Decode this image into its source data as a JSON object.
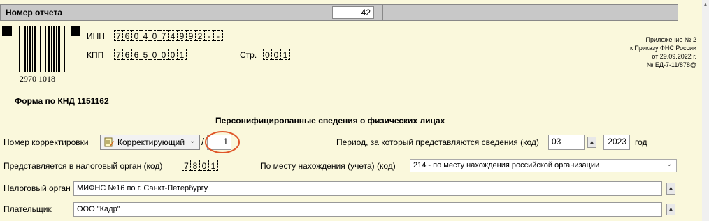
{
  "header": {
    "title": "Номер отчета",
    "report_number": "42"
  },
  "barcode": {
    "number": "2970 1018"
  },
  "inn": {
    "label": "ИНН",
    "cells": [
      "7",
      "6",
      "0",
      "4",
      "0",
      "7",
      "4",
      "9",
      "9",
      "2",
      "-",
      "-"
    ]
  },
  "kpp": {
    "label": "КПП",
    "cells": [
      "7",
      "6",
      "6",
      "5",
      "0",
      "0",
      "0",
      "1"
    ]
  },
  "page": {
    "label": "Стр.",
    "cells": [
      "0",
      "0",
      "1"
    ]
  },
  "appendix": {
    "line1": "Приложение № 2",
    "line2": "к Приказу ФНС России",
    "line3": "от 29.09.2022 г.",
    "line4": "№ ЕД-7-11/878@"
  },
  "form": {
    "code": "Форма по КНД 1151162",
    "heading": "Персонифицированные сведения о физических лицах"
  },
  "correction": {
    "label": "Номер корректировки",
    "type": "Корректирующий",
    "slash": "/",
    "number": "1"
  },
  "period": {
    "label": "Период, за который представляются сведения (код)",
    "code": "03",
    "year": "2023",
    "year_label": "год"
  },
  "tax_office": {
    "label": "Представляется в налоговый орган (код)",
    "cells": [
      "7",
      "8",
      "0",
      "1"
    ]
  },
  "location": {
    "label": "По месту нахождения (учета) (код)",
    "value": "214 - по месту нахождения российской организации"
  },
  "tax_authority": {
    "label": "Налоговый орган",
    "value": "МИФНС №16 по г. Санкт-Петербургу"
  },
  "payer": {
    "label": "Плательщик",
    "value": "ООО \"Кадр\""
  },
  "colors": {
    "background": "#faf8dc",
    "highlight_circle": "#e0572a"
  }
}
